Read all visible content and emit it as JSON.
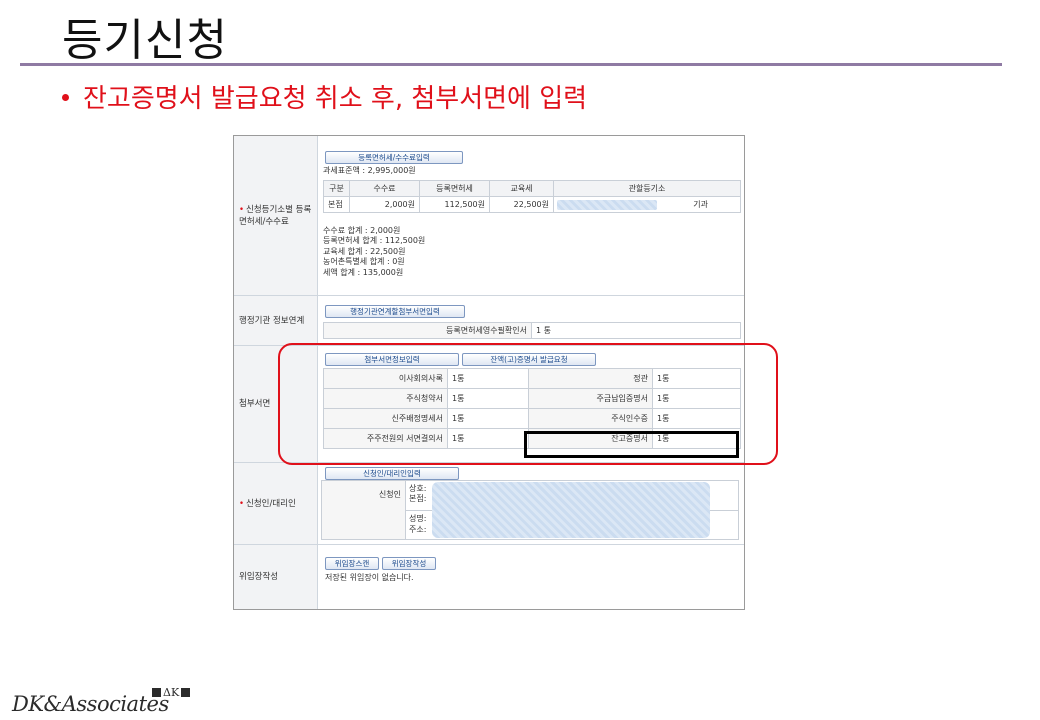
{
  "slide": {
    "title": "등기신청",
    "bullet": "잔고증명서 발급요청 취소 후, 첨부서면에 입력",
    "logo_text": "DK&Associates",
    "logo_mark": "ΔK"
  },
  "form": {
    "fee_section": {
      "label": "신청등기소별 등록면허세/수수료",
      "button": "등록면허세/수수료입력",
      "tax_base": "과세표준액 : 2,995,000원",
      "headers": [
        "구분",
        "수수료",
        "등록면허세",
        "교육세",
        "관할등기소"
      ],
      "row": [
        "본점",
        "2,000원",
        "112,500원",
        "22,500원",
        "기과"
      ],
      "summary": [
        "수수료 합계 : 2,000원",
        "등록면허세 합계 : 112,500원",
        "교육세 합계 : 22,500원",
        "농어촌특별세 합계 : 0원",
        "세액 합계 : 135,000원"
      ]
    },
    "admin_section": {
      "label": "행정기관 정보연계",
      "button": "행정기관연계할첨부서면입력",
      "row_label": "등록면허세영수필확인서",
      "row_value": "1 통"
    },
    "attach_section": {
      "label": "첨부서면",
      "button_attach": "첨부서면정보입력",
      "button_balance": "잔액(고)증명서 발급요청",
      "rows": [
        {
          "left_label": "이사회의사록",
          "left_value": "1통",
          "right_label": "정관",
          "right_value": "1통"
        },
        {
          "left_label": "주식청약서",
          "left_value": "1통",
          "right_label": "주금납입증명서",
          "right_value": "1통"
        },
        {
          "left_label": "신주배정명세서",
          "left_value": "1통",
          "right_label": "주식인수증",
          "right_value": "1통"
        },
        {
          "left_label": "주주전원의 서면결의서",
          "left_value": "1통",
          "right_label": "잔고증명서",
          "right_value": "1통"
        }
      ]
    },
    "applicant_section": {
      "label": "신청인/대리인",
      "button": "신청인/대리인입력",
      "applicant_label": "신청인",
      "field_name": "상호:",
      "field_office": "본점:",
      "field_person": "성명:",
      "field_address": "주소:"
    },
    "poa_section": {
      "label": "위임장작성",
      "button_scan": "위임장스캔",
      "button_write": "위임장작성",
      "empty_text": "저장된 위임장이 없습니다."
    }
  },
  "colors": {
    "highlight_red": "#e0101a",
    "title_rule": "#8f7aa3",
    "button_text": "#1c4a8c"
  }
}
